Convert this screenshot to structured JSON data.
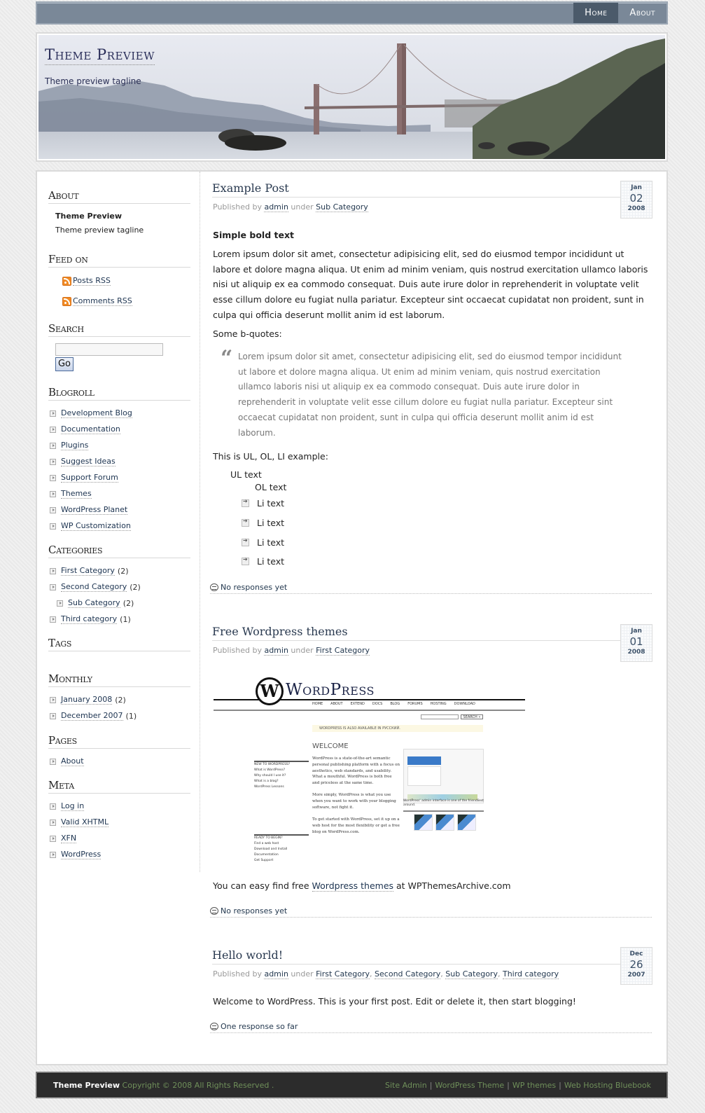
{
  "nav": {
    "tabs": [
      {
        "label": "Home",
        "active": true
      },
      {
        "label": "About",
        "active": false
      }
    ]
  },
  "header": {
    "title": "Theme Preview",
    "tagline": "Theme preview tagline"
  },
  "sidebar": {
    "about": {
      "title": "About",
      "name": "Theme Preview",
      "tagline": "Theme preview tagline"
    },
    "feed": {
      "title": "Feed on",
      "items": [
        "Posts RSS",
        "Comments RSS"
      ]
    },
    "search": {
      "title": "Search",
      "value": "",
      "button": "Go"
    },
    "blogroll": {
      "title": "Blogroll",
      "items": [
        "Development Blog",
        "Documentation",
        "Plugins",
        "Suggest Ideas",
        "Support Forum",
        "Themes",
        "WordPress Planet",
        "WP Customization"
      ]
    },
    "categories": {
      "title": "Categories",
      "items": [
        {
          "label": "First Category",
          "count": "(2)",
          "sub": false
        },
        {
          "label": "Second Category",
          "count": "(2)",
          "sub": false
        },
        {
          "label": "Sub Category",
          "count": "(2)",
          "sub": true
        },
        {
          "label": "Third category",
          "count": "(1)",
          "sub": false
        }
      ]
    },
    "tags": {
      "title": "Tags"
    },
    "monthly": {
      "title": "Monthly",
      "items": [
        {
          "label": "January 2008",
          "count": "(2)"
        },
        {
          "label": "December 2007",
          "count": "(1)"
        }
      ]
    },
    "pages": {
      "title": "Pages",
      "items": [
        "About"
      ]
    },
    "meta": {
      "title": "Meta",
      "items": [
        "Log in",
        "Valid XHTML",
        "XFN",
        "WordPress"
      ]
    }
  },
  "posts": [
    {
      "title": "Example Post",
      "published_by": "Published by",
      "author": "admin",
      "under": "under",
      "categories": [
        "Sub Category"
      ],
      "date": {
        "month": "Jan",
        "day": "02",
        "year": "2008"
      },
      "bold_text": "Simple bold text",
      "paragraph": "Lorem ipsum dolor sit amet, consectetur adipisicing elit, sed do eiusmod tempor incididunt ut labore et dolore magna aliqua. Ut enim ad minim veniam, quis nostrud exercitation ullamco laboris nisi ut aliquip ex ea commodo consequat. Duis aute irure dolor in reprehenderit in voluptate velit esse cillum dolore eu fugiat nulla pariatur. Excepteur sint occaecat cupidatat non proident, sunt in culpa qui officia deserunt mollit anim id est laborum.",
      "bquotes_label": "Some b-quotes:",
      "quote_mark": "“",
      "quote": "Lorem ipsum dolor sit amet, consectetur adipisicing elit, sed do eiusmod tempor incididunt ut labore et dolore magna aliqua. Ut enim ad minim veniam, quis nostrud exercitation ullamco laboris nisi ut aliquip ex ea commodo consequat. Duis aute irure dolor in reprehenderit in voluptate velit esse cillum dolore eu fugiat nulla pariatur. Excepteur sint occaecat cupidatat non proident, sunt in culpa qui officia deserunt mollit anim id est laborum.",
      "list_label": "This is UL, OL, LI example:",
      "ul_text": "UL text",
      "ol_text": "OL text",
      "li_items": [
        "Li text",
        "Li text",
        "Li text",
        "Li text"
      ],
      "comments": "No responses yet"
    },
    {
      "title": "Free Wordpress themes",
      "published_by": "Published by",
      "author": "admin",
      "under": "under",
      "categories": [
        "First Category"
      ],
      "date": {
        "month": "Jan",
        "day": "01",
        "year": "2008"
      },
      "image": {
        "logo_text": "WordPress",
        "logo_mark": "W",
        "nav": [
          "HOME",
          "ABOUT",
          "EXTEND",
          "DOCS",
          "BLOG",
          "FORUMS",
          "HOSTING",
          "DOWNLOAD"
        ],
        "search_button": "SEARCH »",
        "notice": "WORDPRESS IS ALSO AVAILABLE IN РУССКИЙ.",
        "welcome": "WELCOME",
        "body1": "WordPress is a state-of-the-art semantic personal publishing platform with a focus on aesthetics, web standards, and usability. What a mouthful. WordPress is both free and priceless at the same time.",
        "body2": "More simply, WordPress is what you use when you want to work with your blogging software, not fight it.",
        "body3": "To get started with WordPress, set it up on a web host for the most flexibility or get a free blog on WordPress.com.",
        "side1_title": "NEW TO WORDPRESS?",
        "side1_items": [
          "What is WordPress?",
          "Why should I use it?",
          "What is a blog?",
          "WordPress Lessons"
        ],
        "side2_title": "READY TO BEGIN?",
        "side2_items": [
          "Find a web host",
          "Download and Install",
          "Documentation",
          "Get Support"
        ],
        "admin_caption": "WordPress' admin interface is one of the friendliest around."
      },
      "text_before": "You can easy find free ",
      "link": "Wordpress themes",
      "text_after": " at WPThemesArchive.com",
      "comments": "No responses yet"
    },
    {
      "title": "Hello world!",
      "published_by": "Published by",
      "author": "admin",
      "under": "under",
      "categories": [
        "First Category",
        "Second Category",
        "Sub Category",
        "Third category"
      ],
      "date": {
        "month": "Dec",
        "day": "26",
        "year": "2007"
      },
      "paragraph": "Welcome to WordPress. This is your first post. Edit or delete it, then start blogging!",
      "comments": "One response so far"
    }
  ],
  "footer": {
    "site_name": "Theme Preview",
    "copyright": " Copyright © 2008 All Rights Reserved .",
    "links": [
      "Site Admin",
      "WordPress Theme",
      "WP themes",
      "Web Hosting Bluebook"
    ],
    "separator": "|"
  }
}
